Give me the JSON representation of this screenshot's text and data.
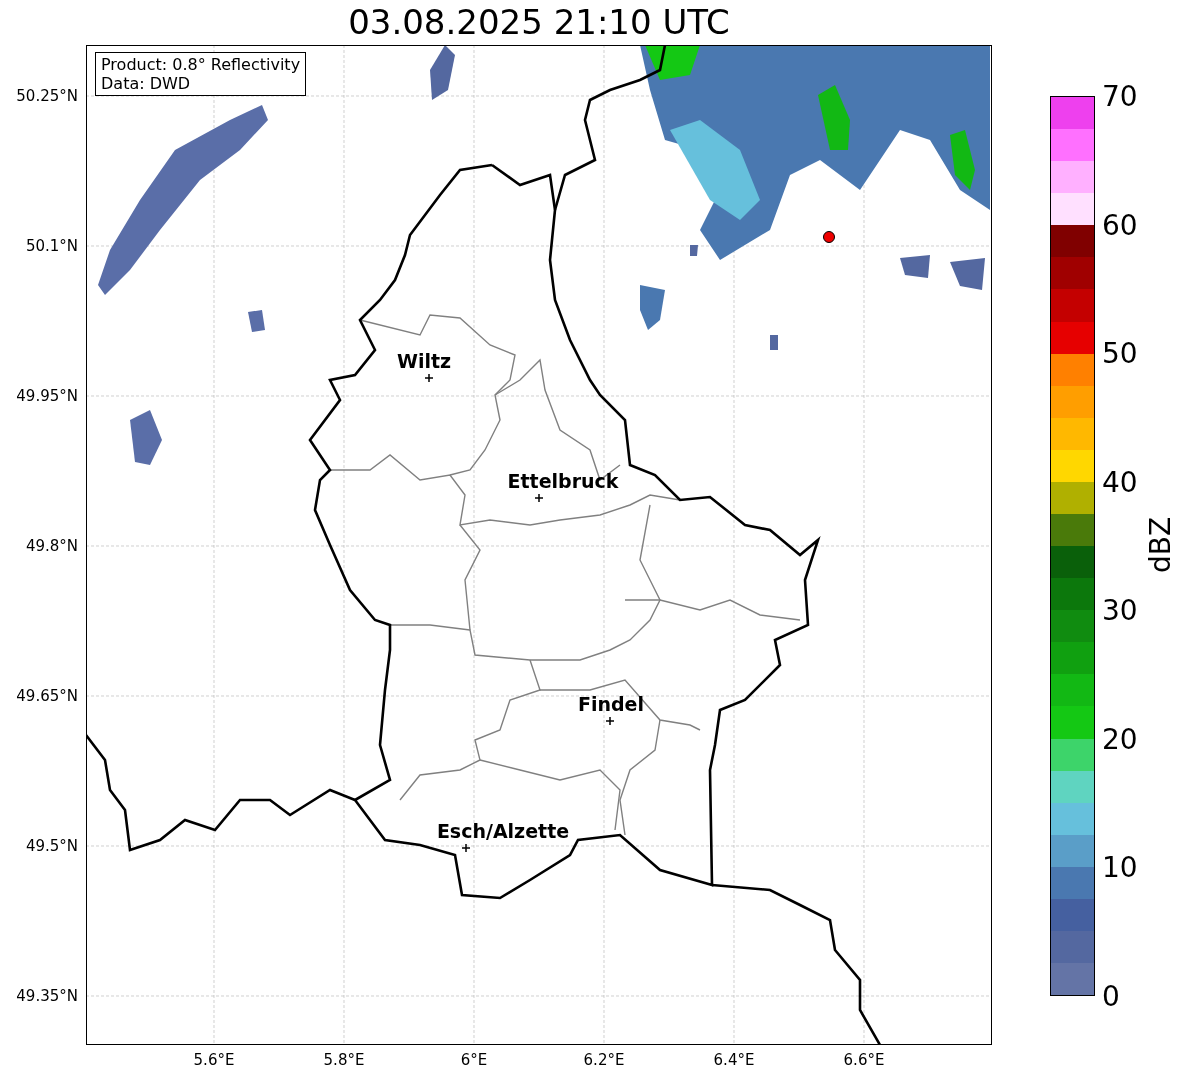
{
  "title": "03.08.2025 21:10 UTC",
  "info_box": {
    "lines": [
      "Product: 0.8° Reflectivity",
      "Data: DWD"
    ]
  },
  "map": {
    "lat_ticks": [
      "50.25°N",
      "50.1°N",
      "49.95°N",
      "49.8°N",
      "49.65°N",
      "49.5°N",
      "49.35°N"
    ],
    "lon_ticks": [
      "5.6°E",
      "5.8°E",
      "6°E",
      "6.2°E",
      "6.4°E",
      "6.6°E"
    ],
    "cities": [
      {
        "name": "Wiltz"
      },
      {
        "name": "Ettelbruck"
      },
      {
        "name": "Findel"
      },
      {
        "name": "Esch/Alzette"
      }
    ]
  },
  "colorbar": {
    "label": "dBZ",
    "ticks": [
      "70",
      "60",
      "50",
      "40",
      "30",
      "20",
      "10",
      "0"
    ],
    "bands": [
      {
        "color": "#ee40ee"
      },
      {
        "color": "#ff70ff"
      },
      {
        "color": "#ffb0ff"
      },
      {
        "color": "#ffe0ff"
      },
      {
        "color": "#800000"
      },
      {
        "color": "#a00000"
      },
      {
        "color": "#c40000"
      },
      {
        "color": "#e60000"
      },
      {
        "color": "#ff8000"
      },
      {
        "color": "#ff9e00"
      },
      {
        "color": "#ffb800"
      },
      {
        "color": "#ffd700"
      },
      {
        "color": "#b0b000"
      },
      {
        "color": "#4a7a0a"
      },
      {
        "color": "#0a600a"
      },
      {
        "color": "#0c780c"
      },
      {
        "color": "#108c10"
      },
      {
        "color": "#10a010"
      },
      {
        "color": "#12b814"
      },
      {
        "color": "#14c814"
      },
      {
        "color": "#3dd46a"
      },
      {
        "color": "#5fd4c0"
      },
      {
        "color": "#66c0dc"
      },
      {
        "color": "#5a9ec8"
      },
      {
        "color": "#4a78b0"
      },
      {
        "color": "#4560a0"
      },
      {
        "color": "#5468a0"
      },
      {
        "color": "#6474a6"
      }
    ]
  }
}
